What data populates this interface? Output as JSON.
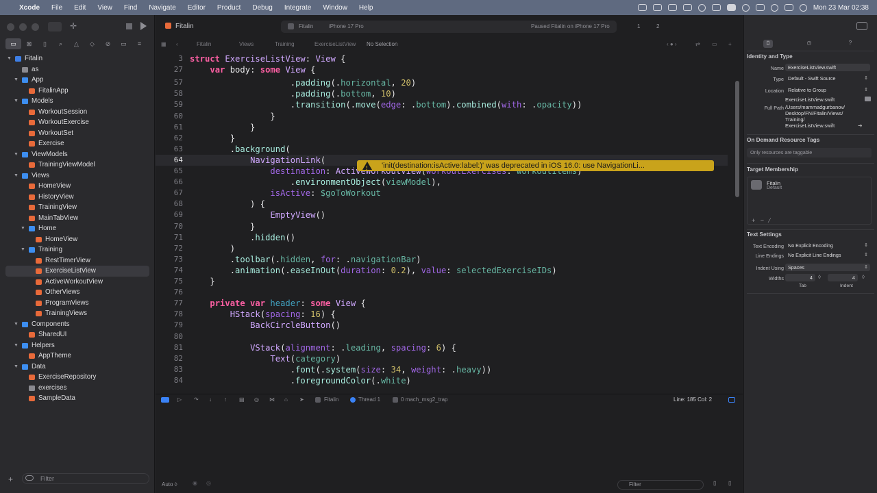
{
  "menubar": {
    "app": "Xcode",
    "items": [
      "File",
      "Edit",
      "View",
      "Find",
      "Navigate",
      "Editor",
      "Product",
      "Debug",
      "Integrate",
      "Window",
      "Help"
    ],
    "datetime": "Mon 23 Mar  02:38"
  },
  "toolbar": {
    "tab_title": "Fitalin",
    "scheme": "Fitalin",
    "destination": "iPhone 17 Pro",
    "status": "Paused Fitalin on iPhone 17 Pro",
    "warnings": "1",
    "errors": "2"
  },
  "jumpbar": {
    "items": [
      "Fitalin",
      "Views",
      "Training",
      "ExerciseListView",
      "No Selection"
    ]
  },
  "navigator": {
    "filter_placeholder": "Filter",
    "tree": [
      {
        "label": "Fitalin",
        "level": 0,
        "kind": "proj",
        "open": true
      },
      {
        "label": "as",
        "level": 1,
        "kind": "json"
      },
      {
        "label": "App",
        "level": 1,
        "kind": "folder",
        "open": true
      },
      {
        "label": "FitalinApp",
        "level": 2,
        "kind": "swift"
      },
      {
        "label": "Models",
        "level": 1,
        "kind": "folder",
        "open": true
      },
      {
        "label": "WorkoutSession",
        "level": 2,
        "kind": "swift"
      },
      {
        "label": "WorkoutExercise",
        "level": 2,
        "kind": "swift"
      },
      {
        "label": "WorkoutSet",
        "level": 2,
        "kind": "swift"
      },
      {
        "label": "Exercise",
        "level": 2,
        "kind": "swift"
      },
      {
        "label": "ViewModels",
        "level": 1,
        "kind": "folder",
        "open": true
      },
      {
        "label": "TrainingViewModel",
        "level": 2,
        "kind": "swift"
      },
      {
        "label": "Views",
        "level": 1,
        "kind": "folder",
        "open": true
      },
      {
        "label": "HomeView",
        "level": 2,
        "kind": "swift"
      },
      {
        "label": "HistoryView",
        "level": 2,
        "kind": "swift"
      },
      {
        "label": "TrainingView",
        "level": 2,
        "kind": "swift"
      },
      {
        "label": "MainTabView",
        "level": 2,
        "kind": "swift"
      },
      {
        "label": "Home",
        "level": 2,
        "kind": "folder",
        "open": true
      },
      {
        "label": "HomeView",
        "level": 3,
        "kind": "swift"
      },
      {
        "label": "Training",
        "level": 2,
        "kind": "folder",
        "open": true
      },
      {
        "label": "RestTimerView",
        "level": 3,
        "kind": "swift"
      },
      {
        "label": "ExerciseListView",
        "level": 3,
        "kind": "swift",
        "selected": true
      },
      {
        "label": "ActiveWorkoutView",
        "level": 3,
        "kind": "swift"
      },
      {
        "label": "OtherViews",
        "level": 3,
        "kind": "swift"
      },
      {
        "label": "ProgramViews",
        "level": 3,
        "kind": "swift"
      },
      {
        "label": "TrainingViews",
        "level": 3,
        "kind": "swift"
      },
      {
        "label": "Components",
        "level": 1,
        "kind": "folder",
        "open": true
      },
      {
        "label": "SharedUI",
        "level": 2,
        "kind": "swift"
      },
      {
        "label": "Helpers",
        "level": 1,
        "kind": "folder",
        "open": true
      },
      {
        "label": "AppTheme",
        "level": 2,
        "kind": "swift"
      },
      {
        "label": "Data",
        "level": 1,
        "kind": "folder",
        "open": true
      },
      {
        "label": "ExerciseRepository",
        "level": 2,
        "kind": "swift"
      },
      {
        "label": "exercises",
        "level": 2,
        "kind": "json"
      },
      {
        "label": "SampleData",
        "level": 2,
        "kind": "swift"
      }
    ]
  },
  "code": {
    "lines": [
      {
        "n": "3",
        "s": [
          [
            "kw",
            "struct "
          ],
          [
            "ty",
            "ExerciseListView"
          ],
          [
            "",
            "': '"
          ],
          [
            "ty",
            "View"
          ],
          [
            "",
            " {"
          ]
        ]
      },
      {
        "n": "27",
        "s": [
          [
            "",
            "    "
          ],
          [
            "kw",
            "var "
          ],
          [
            "",
            "body: "
          ],
          [
            "kw",
            "some "
          ],
          [
            "ty",
            "View"
          ],
          [
            "",
            " {"
          ]
        ]
      },
      {
        "n": "57",
        "s": [
          [
            "",
            "                    ."
          ],
          [
            "fn",
            "padding"
          ],
          [
            "",
            "(."
          ],
          [
            "id",
            "horizontal"
          ],
          [
            "",
            ", "
          ],
          [
            "nm",
            "20"
          ],
          [
            "",
            ")"
          ]
        ]
      },
      {
        "n": "58",
        "s": [
          [
            "",
            "                    ."
          ],
          [
            "fn",
            "padding"
          ],
          [
            "",
            "(."
          ],
          [
            "id",
            "bottom"
          ],
          [
            "",
            ", "
          ],
          [
            "nm",
            "10"
          ],
          [
            "",
            ")"
          ]
        ]
      },
      {
        "n": "59",
        "s": [
          [
            "",
            "                    ."
          ],
          [
            "fn",
            "transition"
          ],
          [
            "",
            "(."
          ],
          [
            "fn",
            "move"
          ],
          [
            "",
            "("
          ],
          [
            "pm",
            "edge"
          ],
          [
            "",
            ": ."
          ],
          [
            "id",
            "bottom"
          ],
          [
            "",
            ")."
          ],
          [
            "fn",
            "combined"
          ],
          [
            "",
            "("
          ],
          [
            "pm",
            "with"
          ],
          [
            "",
            ": ."
          ],
          [
            "id",
            "opacity"
          ],
          [
            "",
            "))"
          ]
        ]
      },
      {
        "n": "60",
        "s": [
          [
            "",
            "                }"
          ]
        ]
      },
      {
        "n": "61",
        "s": [
          [
            "",
            "            }"
          ]
        ]
      },
      {
        "n": "62",
        "s": [
          [
            "",
            "        }"
          ]
        ]
      },
      {
        "n": "63",
        "s": [
          [
            "",
            "        ."
          ],
          [
            "fn",
            "background"
          ],
          [
            "",
            "("
          ]
        ]
      },
      {
        "n": "64",
        "s": [
          [
            "",
            "            "
          ],
          [
            "ty",
            "NavigationLink"
          ],
          [
            "",
            "("
          ]
        ],
        "cur": true
      },
      {
        "n": "65",
        "s": [
          [
            "",
            "                "
          ],
          [
            "pm",
            "destination"
          ],
          [
            "",
            ": "
          ],
          [
            "ty",
            "ActiveWorkoutView"
          ],
          [
            "",
            "("
          ],
          [
            "pm",
            "workoutExercises"
          ],
          [
            "",
            ": "
          ],
          [
            "id",
            "workoutItems"
          ],
          [
            "",
            ")"
          ]
        ]
      },
      {
        "n": "66",
        "s": [
          [
            "",
            "                    ."
          ],
          [
            "fn",
            "environmentObject"
          ],
          [
            "",
            "("
          ],
          [
            "id",
            "viewModel"
          ],
          [
            "",
            "),"
          ]
        ]
      },
      {
        "n": "67",
        "s": [
          [
            "",
            "                "
          ],
          [
            "pm",
            "isActive"
          ],
          [
            "",
            ": "
          ],
          [
            "id",
            "$goToWorkout"
          ]
        ]
      },
      {
        "n": "68",
        "s": [
          [
            "",
            "            ) {"
          ]
        ]
      },
      {
        "n": "69",
        "s": [
          [
            "",
            "                "
          ],
          [
            "ty",
            "EmptyView"
          ],
          [
            "",
            "()"
          ]
        ]
      },
      {
        "n": "70",
        "s": [
          [
            "",
            "            }"
          ]
        ]
      },
      {
        "n": "71",
        "s": [
          [
            "",
            "            ."
          ],
          [
            "fn",
            "hidden"
          ],
          [
            "",
            "()"
          ]
        ]
      },
      {
        "n": "72",
        "s": [
          [
            "",
            "        )"
          ]
        ]
      },
      {
        "n": "73",
        "s": [
          [
            "",
            "        ."
          ],
          [
            "fn",
            "toolbar"
          ],
          [
            "",
            "(."
          ],
          [
            "id",
            "hidden"
          ],
          [
            "",
            ", "
          ],
          [
            "pm",
            "for"
          ],
          [
            "",
            ": ."
          ],
          [
            "id",
            "navigationBar"
          ],
          [
            "",
            ")"
          ]
        ]
      },
      {
        "n": "74",
        "s": [
          [
            "",
            "        ."
          ],
          [
            "fn",
            "animation"
          ],
          [
            "",
            "(."
          ],
          [
            "fn",
            "easeInOut"
          ],
          [
            "",
            "("
          ],
          [
            "pm",
            "duration"
          ],
          [
            "",
            ": "
          ],
          [
            "nm",
            "0.2"
          ],
          [
            "",
            "), "
          ],
          [
            "pm",
            "value"
          ],
          [
            "",
            ": "
          ],
          [
            "id",
            "selectedExerciseIDs"
          ],
          [
            "",
            ")"
          ]
        ]
      },
      {
        "n": "75",
        "s": [
          [
            "",
            "    }"
          ]
        ]
      },
      {
        "n": "76",
        "s": [
          [
            "",
            ""
          ]
        ]
      },
      {
        "n": "77",
        "s": [
          [
            "",
            "    "
          ],
          [
            "kw",
            "private var "
          ],
          [
            "pr",
            "header"
          ],
          [
            "",
            ": "
          ],
          [
            "kw",
            "some "
          ],
          [
            "ty",
            "View"
          ],
          [
            "",
            " {"
          ]
        ]
      },
      {
        "n": "78",
        "s": [
          [
            "",
            "        "
          ],
          [
            "ty",
            "HStack"
          ],
          [
            "",
            "("
          ],
          [
            "pm",
            "spacing"
          ],
          [
            "",
            ": "
          ],
          [
            "nm",
            "16"
          ],
          [
            "",
            ") {"
          ]
        ]
      },
      {
        "n": "79",
        "s": [
          [
            "",
            "            "
          ],
          [
            "ty",
            "BackCircleButton"
          ],
          [
            "",
            "()"
          ]
        ]
      },
      {
        "n": "80",
        "s": [
          [
            "",
            ""
          ]
        ]
      },
      {
        "n": "81",
        "s": [
          [
            "",
            "            "
          ],
          [
            "ty",
            "VStack"
          ],
          [
            "",
            "("
          ],
          [
            "pm",
            "alignment"
          ],
          [
            "",
            ": ."
          ],
          [
            "id",
            "leading"
          ],
          [
            "",
            ", "
          ],
          [
            "pm",
            "spacing"
          ],
          [
            "",
            ": "
          ],
          [
            "nm",
            "6"
          ],
          [
            "",
            ") {"
          ]
        ]
      },
      {
        "n": "82",
        "s": [
          [
            "",
            "                "
          ],
          [
            "ty",
            "Text"
          ],
          [
            "",
            "("
          ],
          [
            "id",
            "category"
          ],
          [
            "",
            ")"
          ]
        ]
      },
      {
        "n": "83",
        "s": [
          [
            "",
            "                    ."
          ],
          [
            "fn",
            "font"
          ],
          [
            "",
            "(."
          ],
          [
            "fn",
            "system"
          ],
          [
            "",
            "("
          ],
          [
            "pm",
            "size"
          ],
          [
            "",
            ": "
          ],
          [
            "nm",
            "34"
          ],
          [
            "",
            ", "
          ],
          [
            "pm",
            "weight"
          ],
          [
            "",
            ": ."
          ],
          [
            "id",
            "heavy"
          ],
          [
            "",
            "))"
          ]
        ]
      },
      {
        "n": "84",
        "s": [
          [
            "",
            "                    ."
          ],
          [
            "fn",
            "foregroundColor"
          ],
          [
            "",
            "(."
          ],
          [
            "id",
            "white"
          ],
          [
            "",
            ")"
          ]
        ]
      }
    ],
    "warning": "'init(destination:isActive:label:)' was deprecated in iOS 16.0: use NavigationLi..."
  },
  "debugbar": {
    "target": "Fitalin",
    "thread": "Thread 1",
    "frame": "0 mach_msg2_trap",
    "position": "Line: 185  Col: 2"
  },
  "bottombar": {
    "auto": "Auto ◊",
    "filter_placeholder": "Filter"
  },
  "inspector": {
    "identity_title": "Identity and Type",
    "name_label": "Name",
    "name_value": "ExerciseListView.swift",
    "type_label": "Type",
    "type_value": "Default - Swift Source",
    "location_label": "Location",
    "location_value": "Relative to Group",
    "location_file": "ExerciseListView.swift",
    "fullpath_label": "Full Path",
    "fullpath_lines": [
      "/Users/mammadgurbanov/",
      "Desktop/FN/Fitalin/Views/",
      "Training/",
      "ExerciseListView.swift"
    ],
    "odr_title": "On Demand Resource Tags",
    "odr_value": "Only resources are taggable",
    "membership_title": "Target Membership",
    "member_name": "Fitalin",
    "member_detail": "Default",
    "text_title": "Text Settings",
    "encoding_label": "Text Encoding",
    "encoding_value": "No Explicit Encoding",
    "endings_label": "Line Endings",
    "endings_value": "No Explicit Line Endings",
    "indent_label": "Indent Using",
    "indent_value": "Spaces",
    "widths_label": "Widths",
    "tab_value": "4",
    "indent_width_value": "4",
    "tab_caption": "Tab",
    "indent_caption": "Indent"
  }
}
